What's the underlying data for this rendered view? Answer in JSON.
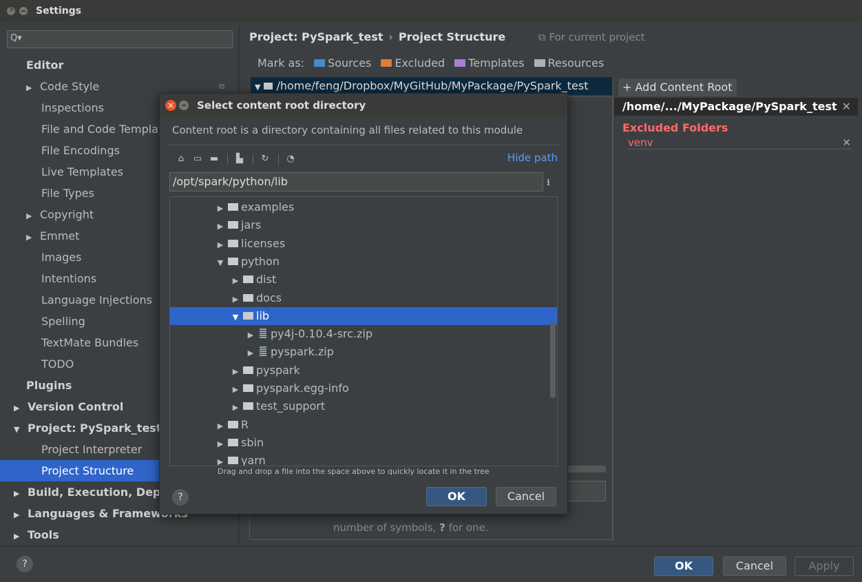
{
  "window": {
    "title": "Settings"
  },
  "search": {
    "prefix": "Q▾"
  },
  "sidebar": {
    "items": [
      {
        "label": "Editor",
        "arrow": "",
        "bold": true
      },
      {
        "label": "Code Style",
        "arrow": "▶",
        "bold": false
      },
      {
        "label": "Inspections",
        "arrow": "",
        "bold": false
      },
      {
        "label": "File and Code Templates",
        "arrow": "",
        "bold": false
      },
      {
        "label": "File Encodings",
        "arrow": "",
        "bold": false
      },
      {
        "label": "Live Templates",
        "arrow": "",
        "bold": false
      },
      {
        "label": "File Types",
        "arrow": "",
        "bold": false
      },
      {
        "label": "Copyright",
        "arrow": "▶",
        "bold": false
      },
      {
        "label": "Emmet",
        "arrow": "▶",
        "bold": false
      },
      {
        "label": "Images",
        "arrow": "",
        "bold": false
      },
      {
        "label": "Intentions",
        "arrow": "",
        "bold": false
      },
      {
        "label": "Language Injections",
        "arrow": "",
        "bold": false
      },
      {
        "label": "Spelling",
        "arrow": "",
        "bold": false
      },
      {
        "label": "TextMate Bundles",
        "arrow": "",
        "bold": false
      },
      {
        "label": "TODO",
        "arrow": "",
        "bold": false
      },
      {
        "label": "Plugins",
        "arrow": "",
        "bold": true
      },
      {
        "label": "Version Control",
        "arrow": "▶",
        "bold": true
      },
      {
        "label": "Project: PySpark_test",
        "arrow": "▼",
        "bold": true
      },
      {
        "label": "Project Interpreter",
        "arrow": "",
        "bold": false
      },
      {
        "label": "Project Structure",
        "arrow": "",
        "bold": false,
        "selected": true
      },
      {
        "label": "Build, Execution, Deployment",
        "arrow": "▶",
        "bold": true
      },
      {
        "label": "Languages & Frameworks",
        "arrow": "▶",
        "bold": true
      },
      {
        "label": "Tools",
        "arrow": "▶",
        "bold": true
      }
    ]
  },
  "breadcrumb": {
    "project": "Project: PySpark_test",
    "separator": "›",
    "page": "Project Structure",
    "scope": "⧉ For current project"
  },
  "mark_as": {
    "label": "Mark as:",
    "items": [
      {
        "label": "Sources",
        "color": "#4a8bc2"
      },
      {
        "label": "Excluded",
        "color": "#e07b39"
      },
      {
        "label": "Templates",
        "color": "#a77fd1"
      },
      {
        "label": "Resources",
        "color": "#b0b0b0"
      }
    ]
  },
  "content_root": {
    "path": "/home/feng/Dropbox/MyGitHub/MyPackage/PySpark_test",
    "add_label": "+ Add Content Root",
    "header": "/home/.../MyPackage/PySpark_test",
    "excluded_title": "Excluded Folders",
    "excluded": [
      "venv"
    ]
  },
  "hint": {
    "pre": "number of symbols, ",
    "q": "?",
    "post": " for one."
  },
  "dialog": {
    "title": "Select content root directory",
    "description": "Content root is a directory containing all files related to this module",
    "hide_path": "Hide path",
    "path": "/opt/spark/python/lib",
    "tree": [
      {
        "label": "examples",
        "arrow": "▶",
        "level": 0,
        "kind": "folder"
      },
      {
        "label": "jars",
        "arrow": "▶",
        "level": 0,
        "kind": "folder"
      },
      {
        "label": "licenses",
        "arrow": "▶",
        "level": 0,
        "kind": "folder"
      },
      {
        "label": "python",
        "arrow": "▼",
        "level": 0,
        "kind": "folder"
      },
      {
        "label": "dist",
        "arrow": "▶",
        "level": 1,
        "kind": "folder"
      },
      {
        "label": "docs",
        "arrow": "▶",
        "level": 1,
        "kind": "folder"
      },
      {
        "label": "lib",
        "arrow": "▼",
        "level": 1,
        "kind": "folder",
        "selected": true
      },
      {
        "label": "py4j-0.10.4-src.zip",
        "arrow": "▶",
        "level": 2,
        "kind": "zip"
      },
      {
        "label": "pyspark.zip",
        "arrow": "▶",
        "level": 2,
        "kind": "zip"
      },
      {
        "label": "pyspark",
        "arrow": "▶",
        "level": 1,
        "kind": "folder"
      },
      {
        "label": "pyspark.egg-info",
        "arrow": "▶",
        "level": 1,
        "kind": "folder"
      },
      {
        "label": "test_support",
        "arrow": "▶",
        "level": 1,
        "kind": "folder"
      },
      {
        "label": "R",
        "arrow": "▶",
        "level": 0,
        "kind": "folder"
      },
      {
        "label": "sbin",
        "arrow": "▶",
        "level": 0,
        "kind": "folder"
      },
      {
        "label": "yarn",
        "arrow": "▶",
        "level": 0,
        "kind": "folder"
      }
    ],
    "drag_hint": "Drag and drop a file into the space above to quickly locate it in the tree",
    "help": "?",
    "ok": "OK",
    "cancel": "Cancel"
  },
  "footer": {
    "help": "?",
    "ok": "OK",
    "cancel": "Cancel",
    "apply": "Apply"
  }
}
